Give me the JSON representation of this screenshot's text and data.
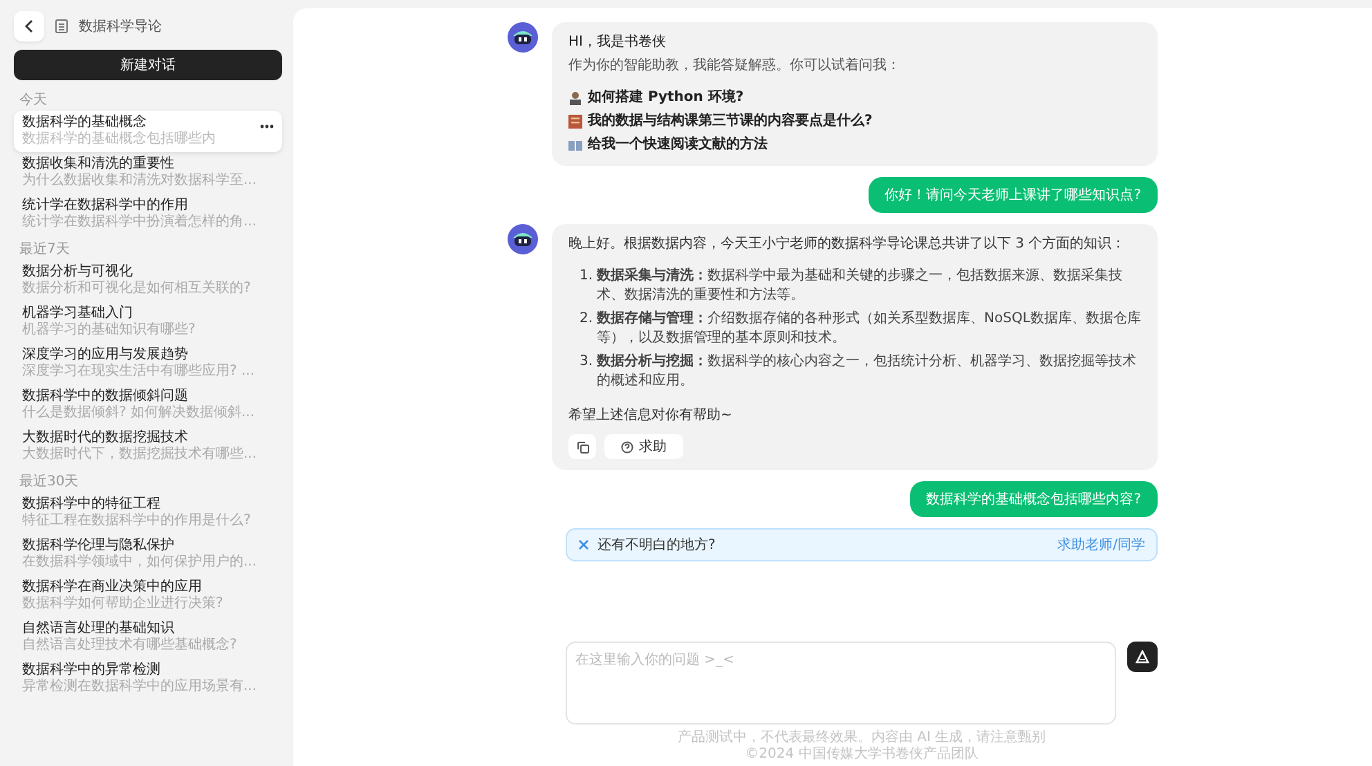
{
  "sidebar": {
    "course_title": "数据科学导论",
    "new_chat": "新建对话",
    "sections": [
      {
        "label": "今天",
        "items": [
          {
            "title": "数据科学的基础概念",
            "preview": "数据科学的基础概念包括哪些内",
            "selected": true
          },
          {
            "title": "数据收集和清洗的重要性",
            "preview": "为什么数据收集和清洗对数据科学至...",
            "selected": false
          },
          {
            "title": "统计学在数据科学中的作用",
            "preview": "统计学在数据科学中扮演着怎样的角...",
            "selected": false
          }
        ]
      },
      {
        "label": "最近7天",
        "items": [
          {
            "title": "数据分析与可视化",
            "preview": "数据分析和可视化是如何相互关联的?",
            "selected": false
          },
          {
            "title": "机器学习基础入门",
            "preview": "机器学习的基础知识有哪些?",
            "selected": false
          },
          {
            "title": "深度学习的应用与发展趋势",
            "preview": "深度学习在现实生活中有哪些应用? ...",
            "selected": false
          },
          {
            "title": "数据科学中的数据倾斜问题",
            "preview": "什么是数据倾斜? 如何解决数据倾斜...",
            "selected": false
          },
          {
            "title": "大数据时代的数据挖掘技术",
            "preview": "大数据时代下，数据挖掘技术有哪些...",
            "selected": false
          }
        ]
      },
      {
        "label": "最近30天",
        "items": [
          {
            "title": "数据科学中的特征工程",
            "preview": "特征工程在数据科学中的作用是什么?",
            "selected": false
          },
          {
            "title": "数据科学伦理与隐私保护",
            "preview": "在数据科学领域中，如何保护用户的...",
            "selected": false
          },
          {
            "title": "数据科学在商业决策中的应用",
            "preview": "数据科学如何帮助企业进行决策?",
            "selected": false
          },
          {
            "title": "自然语言处理的基础知识",
            "preview": "自然语言处理技术有哪些基础概念?",
            "selected": false
          },
          {
            "title": "数据科学中的异常检测",
            "preview": "异常检测在数据科学中的应用场景有...",
            "selected": false
          }
        ]
      }
    ]
  },
  "messages": [
    {
      "kind": "welcome",
      "greeting": "HI，我是书卷侠",
      "intro": "作为你的智能助教，我能答疑解惑。你可以试着问我：",
      "suggestions": [
        "如何搭建 Python 环境?",
        "我的数据与结构课第三节课的内容要点是什么?",
        "给我一个快速阅读文献的方法"
      ]
    },
    {
      "kind": "user",
      "text": "你好！请问今天老师上课讲了哪些知识点?"
    },
    {
      "kind": "answer",
      "intro": "晚上好。根据数据内容，今天王小宁老师的数据科学导论课总共讲了以下 3 个方面的知识：",
      "points": [
        {
          "number": "1.",
          "title": "数据采集与清洗：",
          "body": "数据科学中最为基础和关键的步骤之一，包括数据来源、数据采集技术、数据清洗的重要性和方法等。"
        },
        {
          "number": "2.",
          "title": "数据存储与管理：",
          "body": "介绍数据存储的各种形式（如关系型数据库、NoSQL数据库、数据仓库等），以及数据管理的基本原则和技术。"
        },
        {
          "number": "3.",
          "title": "数据分析与挖掘：",
          "body": "数据科学的核心内容之一，包括统计分析、机器学习、数据挖掘等技术的概述和应用。"
        }
      ],
      "closing": "希望上述信息对你有帮助~",
      "help_button": "求助"
    },
    {
      "kind": "user",
      "text": "数据科学的基础概念包括哪些内容?"
    }
  ],
  "help_bar": {
    "text": "还有不明白的地方?",
    "link": "求助老师/同学"
  },
  "input": {
    "placeholder": "在这里输入你的问题 >_<"
  },
  "footer": [
    "产品测试中，不代表最终效果。内容由 AI 生成，请注意甄别",
    "©2024 中国传媒大学书卷侠产品团队"
  ]
}
